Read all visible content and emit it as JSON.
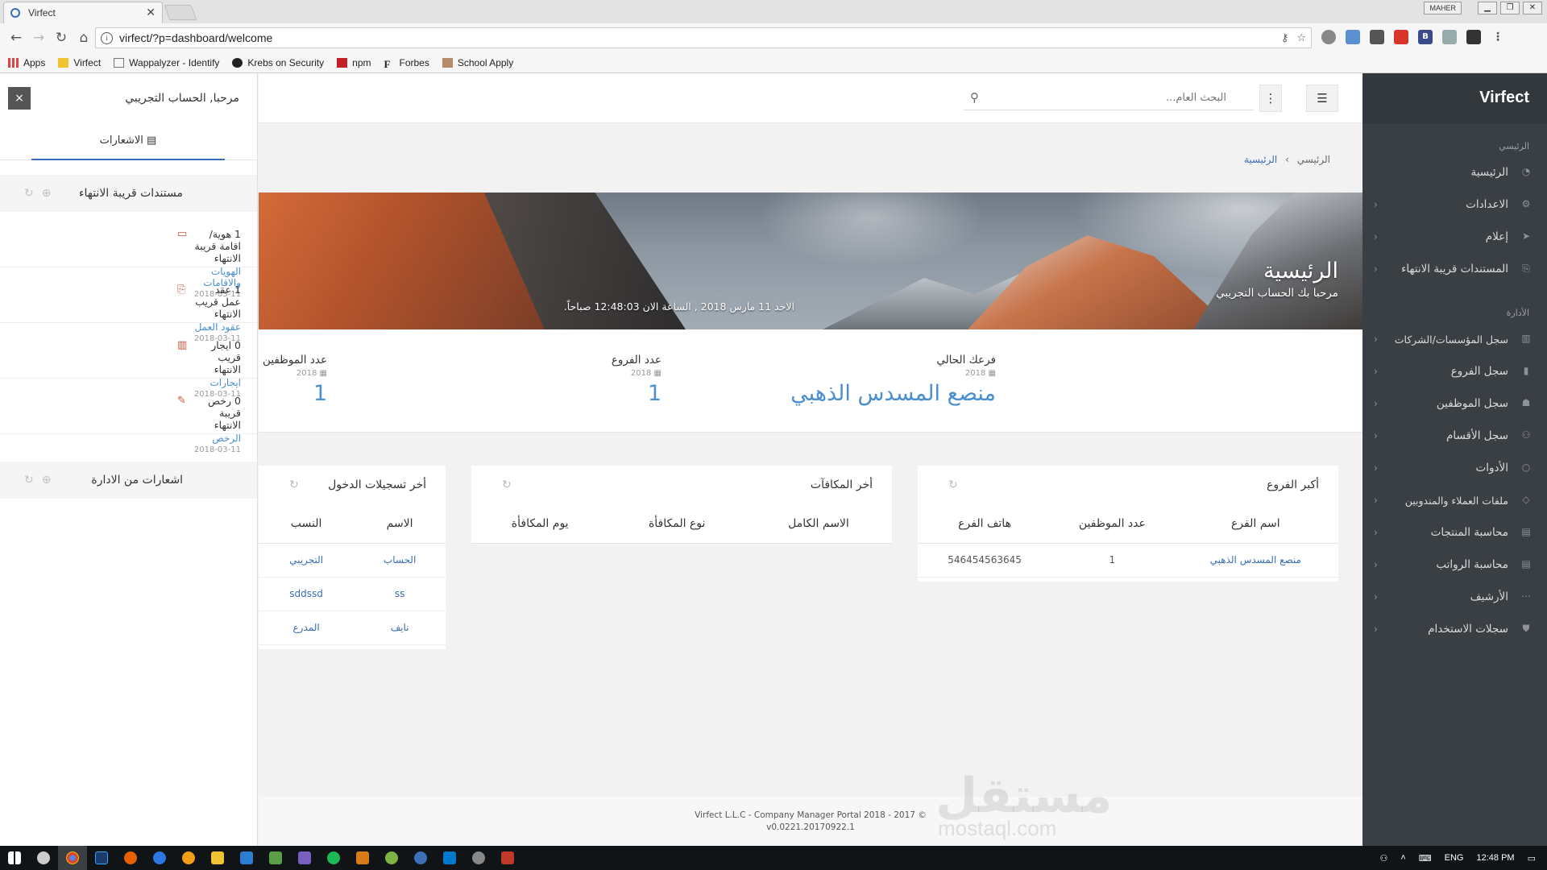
{
  "browser": {
    "tab_title": "Virfect",
    "url": "virfect/?p=dashboard/welcome",
    "user_badge": "MAHER",
    "bookmarks": [
      "Apps",
      "Virfect",
      "Wappalyzer - Identify",
      "Krebs on Security",
      "npm",
      "Forbes",
      "School Apply"
    ]
  },
  "sidebar": {
    "brand": "Virfect",
    "section_main": "الرئيسي",
    "main_items": [
      {
        "label": "الرئيسية",
        "icon": "dashboard-icon"
      },
      {
        "label": "الاعدادات",
        "icon": "gear-icon"
      },
      {
        "label": "إعلام",
        "icon": "send-icon"
      },
      {
        "label": "المستندات قريبة الانتهاء",
        "icon": "documents-icon"
      }
    ],
    "section_admin": "الأدارة",
    "admin_items": [
      {
        "label": "سجل المؤسسات/الشركات",
        "icon": "building-icon"
      },
      {
        "label": "سجل الفروع",
        "icon": "branch-icon"
      },
      {
        "label": "سجل الموظفين",
        "icon": "users-icon"
      },
      {
        "label": "سجل الأقسام",
        "icon": "departments-icon"
      },
      {
        "label": "الأدوات",
        "icon": "tools-icon"
      },
      {
        "label": "ملفات العملاء والمندوبين",
        "icon": "diamond-icon"
      },
      {
        "label": "محاسبة المنتجات",
        "icon": "briefcase-icon"
      },
      {
        "label": "محاسبة الرواتب",
        "icon": "wallet-icon"
      },
      {
        "label": "الأرشيف",
        "icon": "archive-icon"
      },
      {
        "label": "سجلات الاستخدام",
        "icon": "shield-icon"
      }
    ]
  },
  "notifications": {
    "greeting": "مرحبا, الحساب التجريبي",
    "close": "×",
    "tab_label": "الاشعارات",
    "group1_title": "مستندات قريبة الانتهاء",
    "items": [
      {
        "title": "1 هوية/اقامة قريبة الانتهاء",
        "link": "الهويات والاقامات",
        "date": "2018-03-11"
      },
      {
        "title": "1 عقد عمل قريب الانتهاء",
        "link": "عقود العمل",
        "date": "2018-03-11"
      },
      {
        "title": "0 ايجار قريب الانتهاء",
        "link": "ايجارات",
        "date": "2018-03-11"
      },
      {
        "title": "0 رخص قريبة الانتهاء",
        "link": "الرخص",
        "date": "2018-03-11"
      }
    ],
    "group2_title": "اشعارات من الادارة"
  },
  "topbar": {
    "search_placeholder": "البحث العام..."
  },
  "breadcrumb": {
    "root": "الرئيسي",
    "sep": "›",
    "current": "الرئيسية"
  },
  "hero": {
    "title": "الرئيسية",
    "subtitle": "مرحبا بك الحساب التجريبي",
    "datetime": "الاحد 11 مارس 2018 , الساعة الان 12:48:03 صباحاً."
  },
  "stats": [
    {
      "label": "فرعك الحالي",
      "year": "2018",
      "value": "منصع المسدس الذهبي"
    },
    {
      "label": "عدد الفروع",
      "year": "2018",
      "value": "1"
    },
    {
      "label": "عدد الموظفين",
      "year": "2018",
      "value": "1"
    }
  ],
  "branches_card": {
    "title": "أكبر الفروع",
    "headers": [
      "اسم الفرع",
      "عدد الموظفين",
      "هاتف الفرع"
    ],
    "rows": [
      [
        "منصع المسدس الذهبي",
        "1",
        "546454563645"
      ]
    ]
  },
  "rewards_card": {
    "title": "أخر المكافآت",
    "headers": [
      "الاسم الكامل",
      "نوع المكافأة",
      "يوم المكافأة"
    ]
  },
  "logins_card": {
    "title": "أخر تسجيلات الدخول",
    "headers": [
      "الاسم",
      "النسب"
    ],
    "rows": [
      [
        "الحساب",
        "التجريبي"
      ],
      [
        "ss",
        "sddssd"
      ],
      [
        "نايف",
        "المدرع"
      ]
    ]
  },
  "footer": {
    "line1": "Virfect L.L.C - Company Manager Portal 2018 - 2017 ©",
    "line2": "v0.0221.20170922.1"
  },
  "watermark": {
    "line1": "مستقل",
    "line2": "mostaql.com"
  },
  "taskbar": {
    "lang": "ENG",
    "time": "12:48 PM"
  }
}
